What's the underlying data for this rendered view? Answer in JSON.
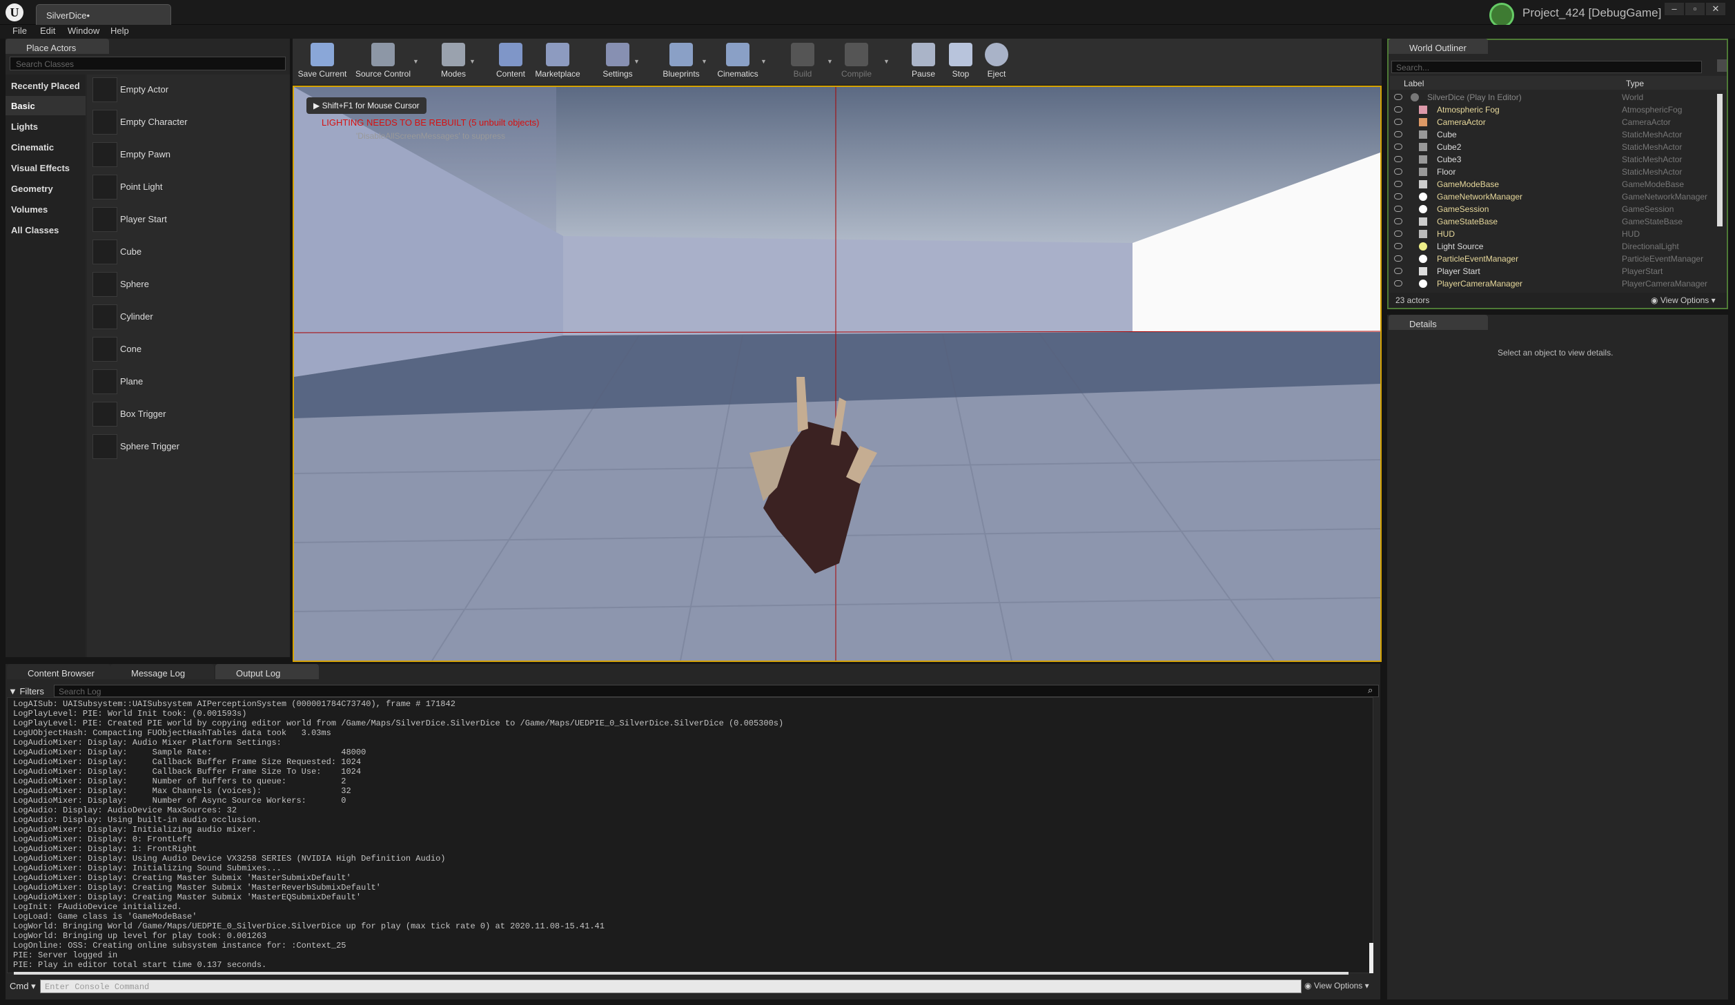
{
  "app": {
    "doc_tab": "SilverDice•",
    "project": "Project_424 [DebugGame]",
    "win_min": "–",
    "win_max": "▫",
    "win_close": "✕"
  },
  "menu": [
    "File",
    "Edit",
    "Window",
    "Help"
  ],
  "place_actors": {
    "tab": "Place Actors",
    "search_placeholder": "Search Classes",
    "categories": [
      "Recently Placed",
      "Basic",
      "Lights",
      "Cinematic",
      "Visual Effects",
      "Geometry",
      "Volumes",
      "All Classes"
    ],
    "selected_category": "Basic",
    "items": [
      "Empty Actor",
      "Empty Character",
      "Empty Pawn",
      "Point Light",
      "Player Start",
      "Cube",
      "Sphere",
      "Cylinder",
      "Cone",
      "Plane",
      "Box Trigger",
      "Sphere Trigger"
    ]
  },
  "toolbar": {
    "save": "Save Current",
    "source": "Source Control",
    "modes": "Modes",
    "content": "Content",
    "marketplace": "Marketplace",
    "settings": "Settings",
    "blueprints": "Blueprints",
    "cinematics": "Cinematics",
    "build": "Build",
    "compile": "Compile",
    "pause": "Pause",
    "stop": "Stop",
    "eject": "Eject"
  },
  "viewport": {
    "mouse_hint": "Shift+F1 for Mouse Cursor",
    "warning": "LIGHTING NEEDS TO BE REBUILT (5 unbuilt objects)",
    "suppress": "'DisableAllScreenMessages' to suppress"
  },
  "bottom": {
    "tabs": [
      "Content Browser",
      "Message Log",
      "Output Log"
    ],
    "filters": "Filters",
    "search_placeholder": "Search Log",
    "cmd": "Cmd",
    "cmd_placeholder": "Enter Console Command",
    "view_options": "View Options",
    "log": "LogAISub: UAISubsystem::UAISubsystem AIPerceptionSystem (000001784C73740), frame # 171842\nLogPlayLevel: PIE: World Init took: (0.001593s)\nLogPlayLevel: PIE: Created PIE world by copying editor world from /Game/Maps/SilverDice.SilverDice to /Game/Maps/UEDPIE_0_SilverDice.SilverDice (0.005300s)\nLogUObjectHash: Compacting FUObjectHashTables data took   3.03ms\nLogAudioMixer: Display: Audio Mixer Platform Settings:\nLogAudioMixer: Display:     Sample Rate:                          48000\nLogAudioMixer: Display:     Callback Buffer Frame Size Requested: 1024\nLogAudioMixer: Display:     Callback Buffer Frame Size To Use:    1024\nLogAudioMixer: Display:     Number of buffers to queue:           2\nLogAudioMixer: Display:     Max Channels (voices):                32\nLogAudioMixer: Display:     Number of Async Source Workers:       0\nLogAudio: Display: AudioDevice MaxSources: 32\nLogAudio: Display: Using built-in audio occlusion.\nLogAudioMixer: Display: Initializing audio mixer.\nLogAudioMixer: Display: 0: FrontLeft\nLogAudioMixer: Display: 1: FrontRight\nLogAudioMixer: Display: Using Audio Device VX3258 SERIES (NVIDIA High Definition Audio)\nLogAudioMixer: Display: Initializing Sound Submixes...\nLogAudioMixer: Display: Creating Master Submix 'MasterSubmixDefault'\nLogAudioMixer: Display: Creating Master Submix 'MasterReverbSubmixDefault'\nLogAudioMixer: Display: Creating Master Submix 'MasterEQSubmixDefault'\nLogInit: FAudioDevice initialized.\nLogLoad: Game class is 'GameModeBase'\nLogWorld: Bringing World /Game/Maps/UEDPIE_0_SilverDice.SilverDice up for play (max tick rate 0) at 2020.11.08-15.41.41\nLogWorld: Bringing up level for play took: 0.001263\nLogOnline: OSS: Creating online subsystem instance for: :Context_25\nPIE: Server logged in\nPIE: Play in editor total start time 0.137 seconds."
  },
  "outliner": {
    "tab": "World Outliner",
    "search_placeholder": "Search...",
    "col_label": "Label",
    "col_type": "Type",
    "count": "23 actors",
    "view_options": "View Options",
    "rows": [
      {
        "name": "SilverDice (Play In Editor)",
        "type": "World"
      },
      {
        "name": "Atmospheric Fog",
        "type": "AtmosphericFog"
      },
      {
        "name": "CameraActor",
        "type": "CameraActor"
      },
      {
        "name": "Cube",
        "type": "StaticMeshActor"
      },
      {
        "name": "Cube2",
        "type": "StaticMeshActor"
      },
      {
        "name": "Cube3",
        "type": "StaticMeshActor"
      },
      {
        "name": "Floor",
        "type": "StaticMeshActor"
      },
      {
        "name": "GameModeBase",
        "type": "GameModeBase"
      },
      {
        "name": "GameNetworkManager",
        "type": "GameNetworkManager"
      },
      {
        "name": "GameSession",
        "type": "GameSession"
      },
      {
        "name": "GameStateBase",
        "type": "GameStateBase"
      },
      {
        "name": "HUD",
        "type": "HUD"
      },
      {
        "name": "Light Source",
        "type": "DirectionalLight"
      },
      {
        "name": "ParticleEventManager",
        "type": "ParticleEventManager"
      },
      {
        "name": "Player Start",
        "type": "PlayerStart"
      },
      {
        "name": "PlayerCameraManager",
        "type": "PlayerCameraManager"
      }
    ]
  },
  "details": {
    "tab": "Details",
    "empty": "Select an object to view details."
  }
}
